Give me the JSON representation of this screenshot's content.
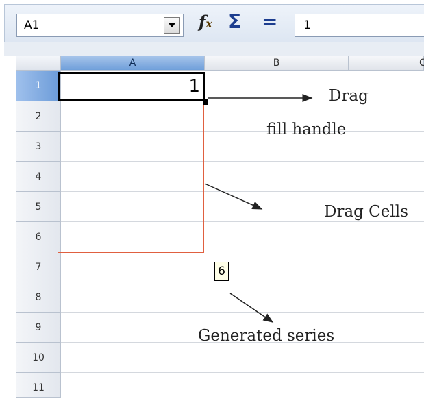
{
  "formula_bar": {
    "name_box": "A1",
    "formula_value": "1",
    "icons": [
      "dropdown-arrow-icon",
      "function-wizard-icon",
      "sum-icon",
      "equals-icon"
    ]
  },
  "sheet": {
    "columns": [
      "A",
      "B",
      "C"
    ],
    "rows": [
      "1",
      "2",
      "3",
      "4",
      "5",
      "6",
      "7",
      "8",
      "9",
      "10",
      "11"
    ],
    "active_cell_value": "1",
    "autofill_tooltip": "6"
  },
  "annotations": {
    "drag_line1": "Drag",
    "drag_line2": "fill handle",
    "drag_cells": "Drag Cells",
    "generated_series": "Generated series"
  },
  "colors": {
    "selection_outline": "#e06040",
    "active_header": "#6f9fda"
  }
}
